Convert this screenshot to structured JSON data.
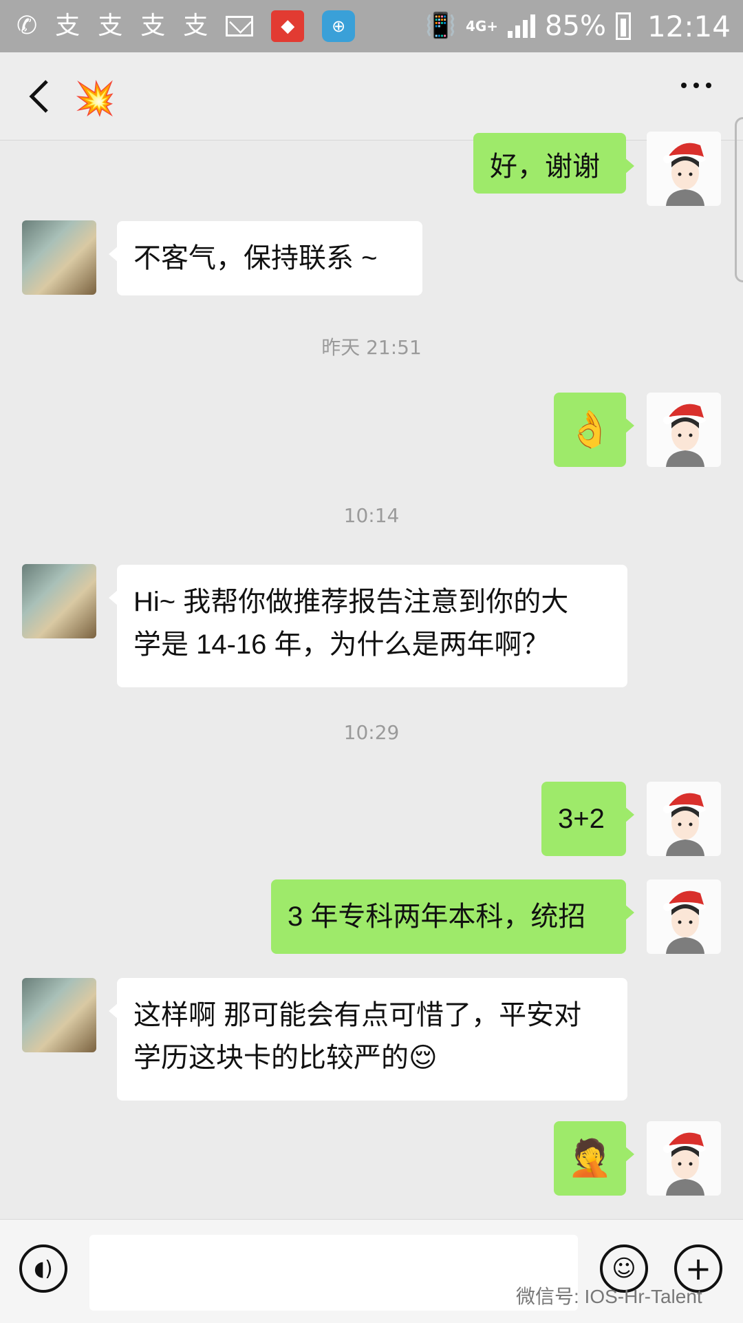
{
  "status_bar": {
    "network": "4G+",
    "battery_percent": "85%",
    "time": "12:14",
    "icons": [
      "missed-call-icon",
      "alipay-icon",
      "alipay-icon",
      "alipay-icon",
      "alipay-icon",
      "mail-icon",
      "bank-app-icon",
      "railway-app-icon",
      "vibrate-icon",
      "signal-icon",
      "battery-icon"
    ]
  },
  "header": {
    "back_icon": "chevron-left-icon",
    "contact_avatar_emoji": "💥",
    "more_icon": "more-horizontal-icon"
  },
  "chat": {
    "messages": [
      {
        "sender": "self",
        "text": "好，谢谢"
      },
      {
        "sender": "other",
        "text": "不客气，保持联系 ~"
      },
      {
        "type": "time",
        "text": "昨天 21:51"
      },
      {
        "sender": "self",
        "emoji": "👌"
      },
      {
        "type": "time",
        "text": "10:14"
      },
      {
        "sender": "other",
        "text_lines": [
          "Hi~ 我帮你做推荐报告注意到你的大",
          "学是 14-16 年，为什么是两年啊？"
        ]
      },
      {
        "type": "time",
        "text": "10:29"
      },
      {
        "sender": "self",
        "text": "3+2"
      },
      {
        "sender": "self",
        "text": "3 年专科两年本科，统招"
      },
      {
        "sender": "other",
        "text_lines": [
          "这样啊 那可能会有点可惜了，平安对",
          "学历这块卡的比较严的😌"
        ]
      },
      {
        "sender": "self",
        "emoji": "🤦"
      }
    ]
  },
  "input_bar": {
    "voice_icon": "voice-icon",
    "emoji_icon": "smiley-icon",
    "plus_icon": "plus-icon",
    "watermark": "微信号: IOS-Hr-Talent"
  }
}
